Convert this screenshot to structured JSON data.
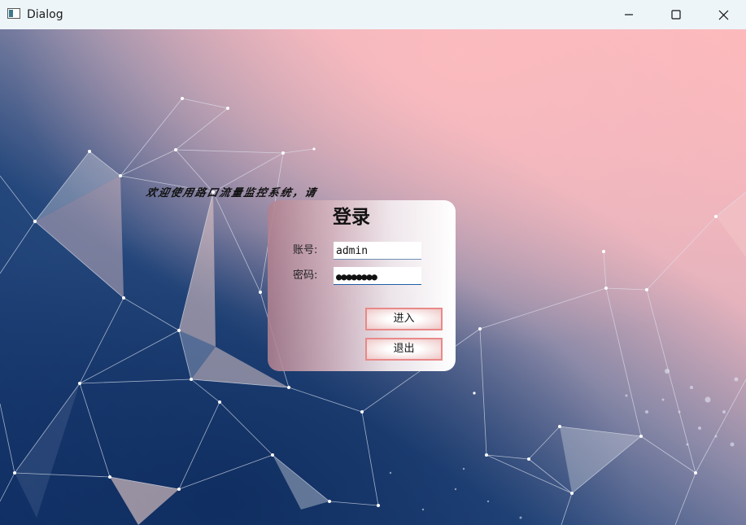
{
  "window": {
    "title": "Dialog",
    "icon": "dialog-window-icon",
    "controls": [
      "minimize-icon",
      "maximize-icon",
      "close-icon"
    ]
  },
  "welcome_text": "欢迎使用路口流量监控系统，请",
  "login": {
    "title": "登录",
    "username_label": "账号:",
    "username_value": "admin",
    "password_label": "密码:",
    "password_value": "●●●●●●●●",
    "enter_button": "进入",
    "exit_button": "退出"
  },
  "colors": {
    "button_border": "#e98989",
    "password_underline": "#1f5fa8",
    "background_top_right": "#fbbabd",
    "background_bottom_left": "#163a70"
  }
}
